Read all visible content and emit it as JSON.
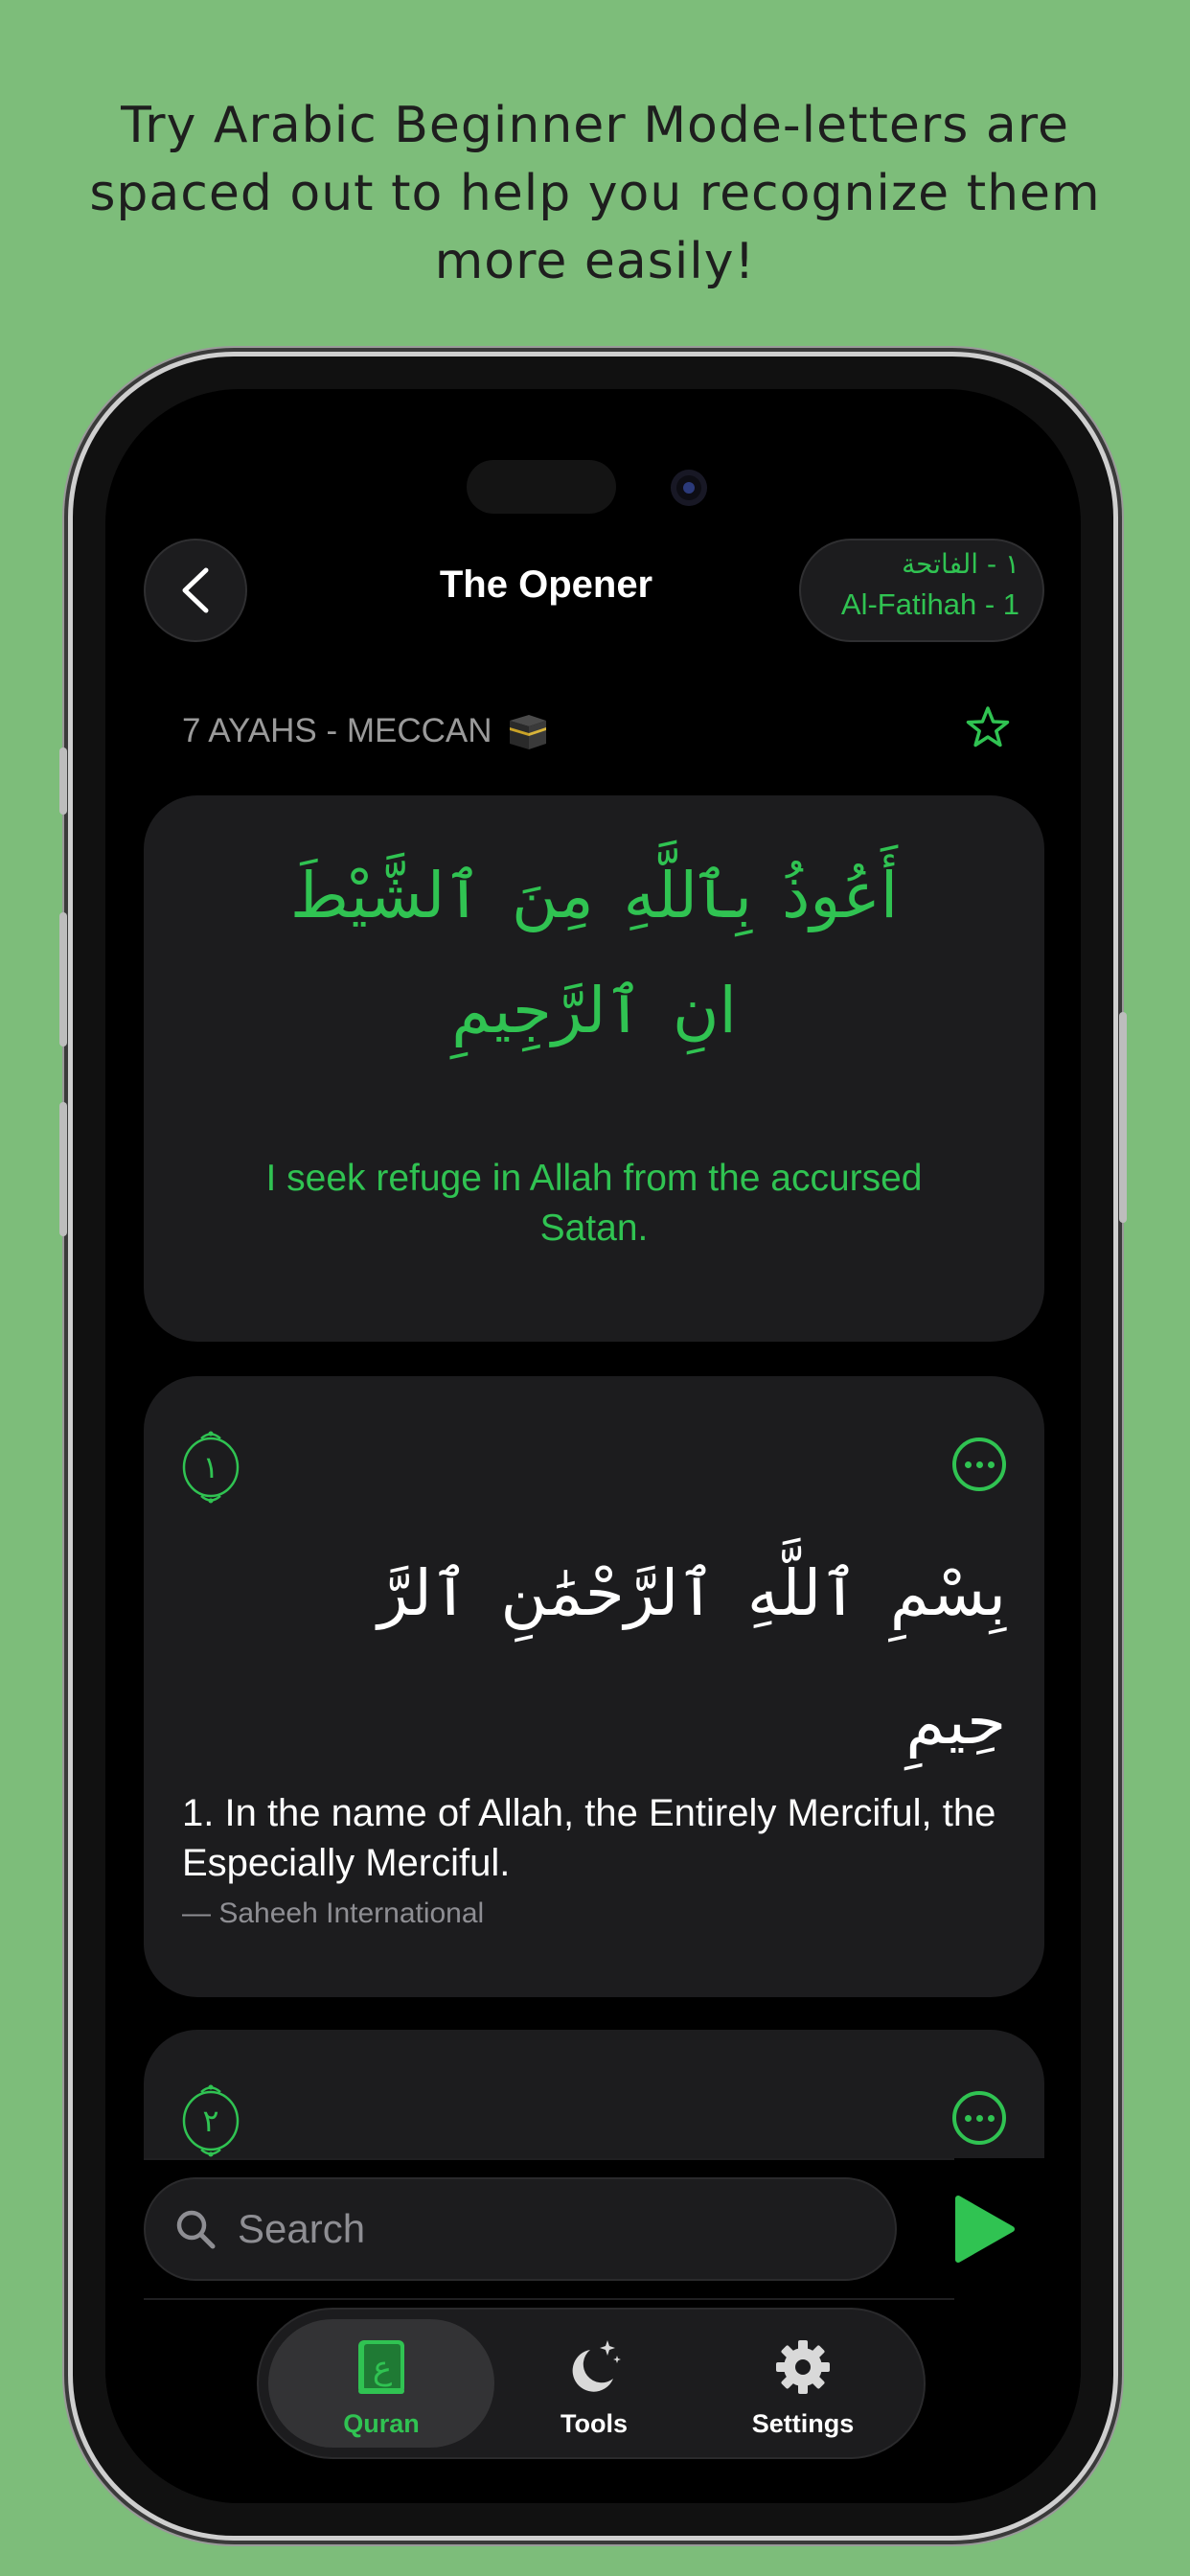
{
  "promo": {
    "text": "Try Arabic Beginner Mode-letters are spaced out to help you recognize them more easily!"
  },
  "header": {
    "title": "The Opener",
    "surah_pill": {
      "arabic": "١ - الفاتحة",
      "english": "Al-Fatihah - 1"
    }
  },
  "meta": {
    "info": "7 AYAHS - MECCAN"
  },
  "isti_adhah": {
    "arabic_line1": "أَعُوذُ بِٱللَّهِ مِنَ ٱلشَّيْطَ",
    "arabic_line2": "انِ ٱلرَّجِيمِ",
    "translation": "I seek refuge in Allah from the accursed Satan."
  },
  "ayahs": [
    {
      "number_arabic": "١",
      "arabic_line1": "بِسْمِ ٱللَّهِ ٱلرَّحْمَٰنِ ٱلرَّ",
      "arabic_line2": "حِيمِ",
      "translation": "1. In the name of Allah, the Entirely Merciful, the Especially Merciful.",
      "attribution": "— Saheeh International"
    },
    {
      "number_arabic": "٢"
    }
  ],
  "search": {
    "placeholder": "Search"
  },
  "tabs": [
    {
      "label": "Quran",
      "icon": "quran-book-icon",
      "active": true
    },
    {
      "label": "Tools",
      "icon": "moon-sparkles-icon",
      "active": false
    },
    {
      "label": "Settings",
      "icon": "gear-icon",
      "active": false
    }
  ],
  "colors": {
    "accent": "#30c352",
    "background": "#7dbd7a",
    "card": "#1c1c1e",
    "screen": "#000000"
  }
}
